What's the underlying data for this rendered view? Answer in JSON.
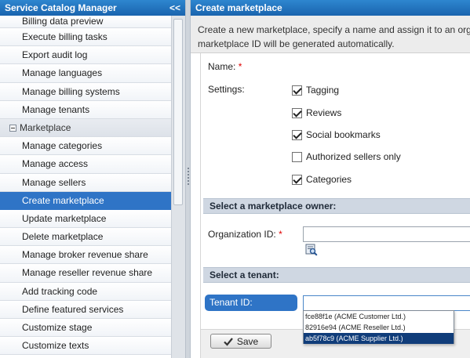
{
  "sidebar": {
    "title": "Service Catalog Manager",
    "collapse_label": "<<",
    "items": [
      {
        "label": "Billing data preview",
        "type": "item"
      },
      {
        "label": "Execute billing tasks",
        "type": "item"
      },
      {
        "label": "Export audit log",
        "type": "item"
      },
      {
        "label": "Manage languages",
        "type": "item"
      },
      {
        "label": "Manage billing systems",
        "type": "item"
      },
      {
        "label": "Manage tenants",
        "type": "item"
      },
      {
        "label": "Marketplace",
        "type": "group"
      },
      {
        "label": "Manage categories",
        "type": "item"
      },
      {
        "label": "Manage access",
        "type": "item"
      },
      {
        "label": "Manage sellers",
        "type": "item"
      },
      {
        "label": "Create marketplace",
        "type": "item",
        "active": true
      },
      {
        "label": "Update marketplace",
        "type": "item"
      },
      {
        "label": "Delete marketplace",
        "type": "item"
      },
      {
        "label": "Manage broker revenue share",
        "type": "item"
      },
      {
        "label": "Manage reseller revenue share",
        "type": "item"
      },
      {
        "label": "Add tracking code",
        "type": "item"
      },
      {
        "label": "Define featured services",
        "type": "item"
      },
      {
        "label": "Customize stage",
        "type": "item"
      },
      {
        "label": "Customize texts",
        "type": "item"
      }
    ]
  },
  "main": {
    "title": "Create marketplace",
    "intro_line1": "Create a new marketplace, specify a name and assign it to an organiz",
    "intro_line2": "marketplace ID will be generated automatically.",
    "name_label": "Name:",
    "required_mark": "*",
    "settings_label": "Settings:",
    "settings": [
      {
        "label": "Tagging",
        "checked": true
      },
      {
        "label": "Reviews",
        "checked": true
      },
      {
        "label": "Social bookmarks",
        "checked": true
      },
      {
        "label": "Authorized sellers only",
        "checked": false
      },
      {
        "label": "Categories",
        "checked": true
      }
    ],
    "owner_section": "Select a marketplace owner:",
    "org_id_label": "Organization ID:",
    "tenant_section": "Select a tenant:",
    "tenant_label": "Tenant ID:",
    "tenant_options": [
      {
        "label": "fce88f1e (ACME Customer Ltd.)",
        "selected": false
      },
      {
        "label": "82916e94 (ACME Reseller Ltd.)",
        "selected": false
      },
      {
        "label": "ab5f78c9 (ACME Supplier Ltd.)",
        "selected": true
      }
    ],
    "save_label": "Save"
  },
  "colors": {
    "header_blue": "#1f6fbf",
    "active_item": "#2f74c6",
    "dropdown_selected": "#103d7a",
    "required": "#e00000"
  }
}
